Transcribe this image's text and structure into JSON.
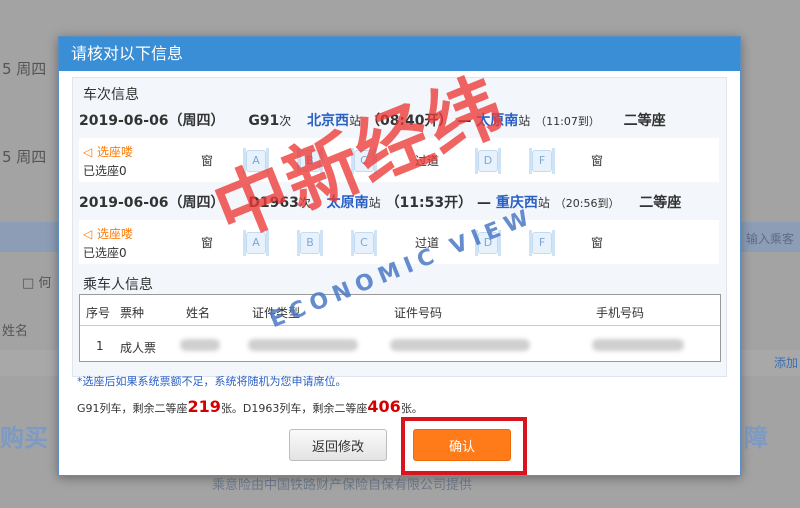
{
  "background": {
    "weekday_1": "5 周四",
    "weekday_2": "5 周四",
    "checkbox_label": "□ 何",
    "name_field": "姓名",
    "add_link": "添加",
    "search_placeholder": "输入乘客",
    "left_big": "购买",
    "right_big": "障",
    "footer": "乘意险由中国铁路财产保险自保有限公司提供"
  },
  "dialog": {
    "title": "请核对以下信息",
    "trains_label": "车次信息",
    "trips": [
      {
        "date": "2019-06-06（周四）",
        "train": "G91",
        "train_suffix": "次",
        "from": "北京西",
        "from_suffix": "站",
        "depart": "（08:40开）",
        "dash": "—",
        "to": "太原南",
        "to_suffix": "站",
        "arrive": "（11:07到）",
        "seat_class": "二等座",
        "seat_map": [
          "A",
          "B",
          "C",
          "D",
          "F"
        ]
      },
      {
        "date": "2019-06-06（周四）",
        "train": "D1963",
        "train_suffix": "次",
        "from": "太原南",
        "from_suffix": "站",
        "depart": "（11:53开）",
        "dash": "—",
        "to": "重庆西",
        "to_suffix": "站",
        "arrive": "（20:56到）",
        "seat_class": "二等座",
        "seat_map": [
          "A",
          "B",
          "C",
          "D",
          "F"
        ]
      }
    ],
    "select_seat": "选座喽",
    "chosen": "已选座0",
    "window": "窗",
    "aisle": "过道",
    "passenger_label": "乘车人信息",
    "table_headers": [
      "序号",
      "票种",
      "姓名",
      "证件类型",
      "证件号码",
      "手机号码"
    ],
    "passengers": [
      {
        "index": "1",
        "ticket_type": "成人票"
      }
    ],
    "note": "*选座后如果系统票额不足，系统将随机为您申请席位。",
    "remaining": {
      "prefix": "G91列车，剩余二等座",
      "count1": "219",
      "mid": "张。D1963列车，剩余二等座",
      "count2": "406",
      "suffix": "张。"
    },
    "back_button": "返回修改",
    "confirm_button": "确认"
  },
  "watermark": {
    "cn": "中新经纬",
    "en": "ECONOMIC VIEW"
  },
  "colors": {
    "header_blue": "#3a8ed6",
    "station_blue": "#2a5fc6",
    "confirm_orange": "#ff7b19",
    "highlight_red": "#d8141e",
    "count_red": "#d40000"
  }
}
